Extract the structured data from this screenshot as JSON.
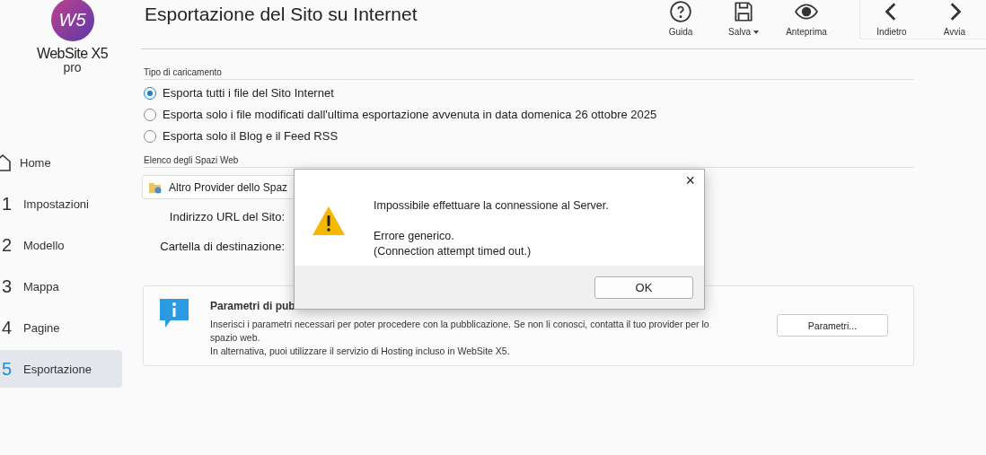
{
  "app": {
    "logo_mark": "W5",
    "logo_name": "WebSite X5",
    "logo_edition": "pro"
  },
  "sidebar": {
    "items": [
      {
        "kind": "home",
        "label": "Home",
        "selected": false
      },
      {
        "kind": "step",
        "number": "1",
        "label": "Impostazioni",
        "selected": false
      },
      {
        "kind": "step",
        "number": "2",
        "label": "Modello",
        "selected": false
      },
      {
        "kind": "step",
        "number": "3",
        "label": "Mappa",
        "selected": false
      },
      {
        "kind": "step",
        "number": "4",
        "label": "Pagine",
        "selected": false
      },
      {
        "kind": "step",
        "number": "5",
        "label": "Esportazione",
        "selected": true
      }
    ]
  },
  "page": {
    "title": "Esportazione del Sito su Internet"
  },
  "toolbar": [
    {
      "kind": "help",
      "label": "Guida",
      "dropdown": false
    },
    {
      "kind": "save",
      "label": "Salva",
      "dropdown": true
    },
    {
      "kind": "preview",
      "label": "Anteprima",
      "dropdown": false
    },
    {
      "kind": "back",
      "label": "Indietro",
      "dropdown": false
    },
    {
      "kind": "next",
      "label": "Avvia",
      "dropdown": false
    }
  ],
  "upload_type": {
    "label": "Tipo di caricamento",
    "options": [
      {
        "label": "Esporta tutti i file del Sito Internet",
        "selected": true
      },
      {
        "label": "Esporta solo i file modificati dall'ultima esportazione avvenuta in data domenica 26 ottobre 2025",
        "selected": false
      },
      {
        "label": "Esporta solo il Blog e il Feed RSS",
        "selected": false
      }
    ]
  },
  "web_spaces": {
    "label": "Elenco degli Spazi Web",
    "selected_space": "Altro Provider dello Spaz",
    "fields": [
      {
        "label": "Indirizzo URL del Sito:"
      },
      {
        "label": "Cartella di destinazione:"
      }
    ]
  },
  "info_panel": {
    "title": "Parametri di pub",
    "lines": [
      "Inserisci i parametri necessari per poter procedere con la pubblicazione. Se non li conosci, contatta il tuo provider per lo spazio web.",
      "In alternativa, puoi utilizzare il servizio di Hosting incluso in WebSite X5."
    ],
    "button": "Parametri..."
  },
  "dialog": {
    "close": "×",
    "message": "Impossibile effettuare la connessione al Server.",
    "detail_lines": [
      "Errore generico.",
      "(Connection attempt timed out.)"
    ],
    "button": "OK"
  }
}
